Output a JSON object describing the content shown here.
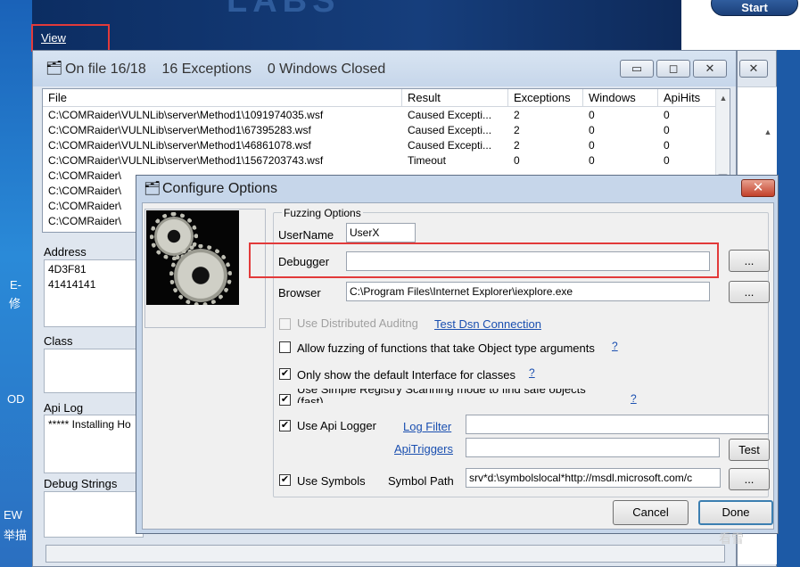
{
  "desktop": {
    "left_labels": [
      "E-",
      "修",
      "OD",
      "EW",
      "举描"
    ],
    "view_link": "View",
    "start_button": "Start",
    "banner_text": "LABS",
    "watermark": "看雪"
  },
  "main_window": {
    "title": "On file 16/18",
    "exceptions_count": "16 Exceptions",
    "windows_closed": "0 Windows Closed",
    "controls": {
      "minimize": "▭",
      "maximize": "◻",
      "close": "✕"
    },
    "list": {
      "columns": [
        "File",
        "Result",
        "Exceptions",
        "Windows",
        "ApiHits"
      ],
      "rows": [
        [
          "C:\\COMRaider\\VULNLib\\server\\Method1\\1091974035.wsf",
          "Caused Excepti...",
          "2",
          "0",
          "0"
        ],
        [
          "C:\\COMRaider\\VULNLib\\server\\Method1\\67395283.wsf",
          "Caused Excepti...",
          "2",
          "0",
          "0"
        ],
        [
          "C:\\COMRaider\\VULNLib\\server\\Method1\\46861078.wsf",
          "Caused Excepti...",
          "2",
          "0",
          "0"
        ],
        [
          "C:\\COMRaider\\VULNLib\\server\\Method1\\1567203743.wsf",
          "Timeout",
          "0",
          "0",
          "0"
        ],
        [
          "C:\\COMRaider\\",
          "",
          "",
          "",
          ""
        ],
        [
          "C:\\COMRaider\\",
          "",
          "",
          "",
          ""
        ],
        [
          "C:\\COMRaider\\",
          "",
          "",
          "",
          ""
        ],
        [
          "C:\\COMRaider\\",
          "",
          "",
          "",
          ""
        ]
      ]
    },
    "address_panel": {
      "label": "Address",
      "values": [
        "4D3F81",
        "41414141"
      ]
    },
    "class_panel": {
      "label": "Class"
    },
    "api_log_panel": {
      "label": "Api Log",
      "values": [
        "***** Installing Ho"
      ]
    },
    "debug_panel": {
      "label": "Debug Strings"
    }
  },
  "dialog": {
    "title": "Configure Options",
    "close": "✕",
    "group_caption": "Fuzzing Options",
    "username_label": "UserName",
    "username_value": "UserX",
    "debugger_label": "Debugger",
    "debugger_value": "",
    "browser_label": "Browser",
    "browser_value": "C:\\Program Files\\Internet Explorer\\iexplore.exe",
    "browse_button": "...",
    "distributed_auditing": "Use Distributed Auditng",
    "test_dsn": "Test Dsn Connection",
    "object_type_args": "Allow fuzzing of functions that take Object type arguments",
    "default_interface": "Only show the default Interface for classes",
    "simple_registry": "Use Simple Registry Scanning mode to find safe objects (fast)",
    "api_logger": "Use Api Logger",
    "log_filter": "Log Filter",
    "api_triggers": "ApiTriggers",
    "test_button": "Test",
    "use_symbols": "Use Symbols",
    "symbol_path_label": "Symbol Path",
    "symbol_path_value": "srv*d:\\symbolslocal*http://msdl.microsoft.com/c",
    "help": "?",
    "checkmark": "✔",
    "cancel_button": "Cancel",
    "done_button": "Done"
  }
}
